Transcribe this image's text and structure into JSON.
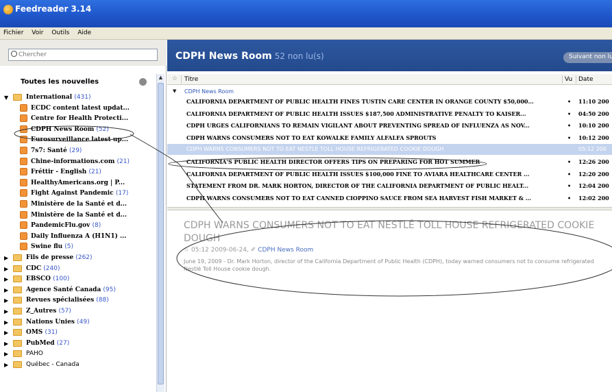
{
  "window": {
    "title": "Feedreader 3.14"
  },
  "menu": [
    "Fichier",
    "Voir",
    "Outils",
    "Aide"
  ],
  "search": {
    "placeholder": "Chercher"
  },
  "sidebar": {
    "header": "Toutes les nouvelles",
    "tree": [
      {
        "name": "International",
        "count": "(431)",
        "depth": 0,
        "kind": "folder",
        "expanded": true
      },
      {
        "name": "ECDC content latest updat...",
        "count": "",
        "depth": 1,
        "kind": "feed"
      },
      {
        "name": "Centre for Health Protecti...",
        "count": "",
        "depth": 1,
        "kind": "feed"
      },
      {
        "name": "CDPH News Room",
        "count": "(52)",
        "depth": 1,
        "kind": "feed"
      },
      {
        "name": "Eurosurveillance latest up...",
        "count": "",
        "depth": 1,
        "kind": "feed"
      },
      {
        "name": "7s7: Santé",
        "count": "(29)",
        "depth": 1,
        "kind": "feed"
      },
      {
        "name": "Chine-informations.com",
        "count": "(21)",
        "depth": 1,
        "kind": "feed"
      },
      {
        "name": "Fréttir - English",
        "count": "(21)",
        "depth": 1,
        "kind": "feed"
      },
      {
        "name": "HealthyAmericans.org | P...",
        "count": "",
        "depth": 1,
        "kind": "feed"
      },
      {
        "name": "Fight Against Pandemic",
        "count": "(17)",
        "depth": 1,
        "kind": "feed"
      },
      {
        "name": "Ministère de la Santé et d...",
        "count": "",
        "depth": 1,
        "kind": "feed"
      },
      {
        "name": "Ministère de la Santé et d...",
        "count": "",
        "depth": 1,
        "kind": "feed"
      },
      {
        "name": "PandemicFlu.gov",
        "count": "(8)",
        "depth": 1,
        "kind": "feed"
      },
      {
        "name": "Daily Influenza A (H1N1) ...",
        "count": "",
        "depth": 1,
        "kind": "feed"
      },
      {
        "name": "Swine flu",
        "count": "(5)",
        "depth": 1,
        "kind": "feed"
      },
      {
        "name": "Fils de presse",
        "count": "(262)",
        "depth": 0,
        "kind": "folder",
        "expanded": false
      },
      {
        "name": "CDC",
        "count": "(240)",
        "depth": 0,
        "kind": "folder",
        "expanded": false
      },
      {
        "name": "EBSCO",
        "count": "(100)",
        "depth": 0,
        "kind": "folder",
        "expanded": false
      },
      {
        "name": "Agence Santé Canada",
        "count": "(95)",
        "depth": 0,
        "kind": "folder",
        "expanded": false
      },
      {
        "name": "Revues spécialisées",
        "count": "(88)",
        "depth": 0,
        "kind": "folder",
        "expanded": false
      },
      {
        "name": "Z_Autres",
        "count": "(57)",
        "depth": 0,
        "kind": "folder",
        "expanded": false
      },
      {
        "name": "Nations Unies",
        "count": "(49)",
        "depth": 0,
        "kind": "folder",
        "expanded": false
      },
      {
        "name": "OMS",
        "count": "(31)",
        "depth": 0,
        "kind": "folder",
        "expanded": false
      },
      {
        "name": "PubMed",
        "count": "(27)",
        "depth": 0,
        "kind": "folder",
        "expanded": false
      },
      {
        "name": "PAHO",
        "count": "",
        "depth": 0,
        "kind": "folder",
        "expanded": false,
        "plain": true
      },
      {
        "name": "Québec - Canada",
        "count": "",
        "depth": 0,
        "kind": "folder",
        "expanded": false,
        "plain": true
      }
    ]
  },
  "main": {
    "title": "CDPH News Room",
    "unread": "52 non lu(s)",
    "next_button": "Suivant non lu",
    "columns": {
      "star": "☆",
      "title": "Titre",
      "vu": "Vu",
      "date": "Date"
    },
    "group": "CDPH News Room",
    "rows": [
      {
        "title": "CALIFORNIA DEPARTMENT OF PUBLIC HEALTH FINES TUSTIN CARE CENTER IN ORANGE COUNTY $50,000...",
        "dot": "•",
        "date": "11:10 200"
      },
      {
        "title": "CALIFORNIA DEPARTMENT OF PUBLIC HEALTH ISSUES $187,500 ADMINISTRATIVE PENALTY TO KAISER...",
        "dot": "•",
        "date": "04:50 200"
      },
      {
        "title": "CDPH URGES CALIFORNIANS TO REMAIN VIGILANT ABOUT PREVENTING SPREAD OF INFLUENZA AS NOV...",
        "dot": "•",
        "date": "10:10 200"
      },
      {
        "title": "CDPH WARNS CONSUMERS NOT TO EAT KOWALKE FAMILY ALFALFA SPROUTS",
        "dot": "•",
        "date": "10:12 200"
      },
      {
        "title": "CDPH WARNS CONSUMERS NOT TO EAT NESTLÉ TOLL HOUSE REFRIGERATED COOKIE DOUGH",
        "dot": "",
        "date": "05:12 200",
        "selected": true
      },
      {
        "title": "CALIFORNIA'S PUBLIC HEALTH DIRECTOR OFFERS TIPS ON PREPARING FOR HOT SUMMER",
        "dot": "•",
        "date": "12:26 200"
      },
      {
        "title": "CALIFORNIA DEPARTMENT OF PUBLIC HEALTH ISSUES $100,000 FINE TO AVIARA HEALTHCARE CENTER ...",
        "dot": "•",
        "date": "12:20 200"
      },
      {
        "title": "STATEMENT FROM DR. MARK HORTON, DIRECTOR OF THE CALIFORNIA DEPARTMENT OF PUBLIC HEALT...",
        "dot": "•",
        "date": "12:04 200"
      },
      {
        "title": "CDPH WARNS CONSUMERS NOT TO EAT CANNED CIOPPINO SAUCE FROM SEA HARVEST FISH MARKET & ...",
        "dot": "•",
        "date": "12:02 200"
      }
    ],
    "article": {
      "title": "CDPH WARNS CONSUMERS NOT TO EAT NESTLÉ TOLL HOUSE REFRIGERATED COOKIE DOUGH",
      "star": "☆",
      "datetime": "05:12 2009-06-24,",
      "source": "CDPH News Room",
      "body": "June 19, 2009 - Dr. Mark Horton, director of the California Department of Public Health (CDPH), today warned consumers not to consume refrigerated Nestlé Toll House cookie dough."
    }
  },
  "colors": {
    "titlebar": "#1e55c9",
    "header": "#2d57a0",
    "selection": "#c4d3ee",
    "count": "#3656c8",
    "folder": "#f3c560",
    "feed": "#f29338"
  }
}
